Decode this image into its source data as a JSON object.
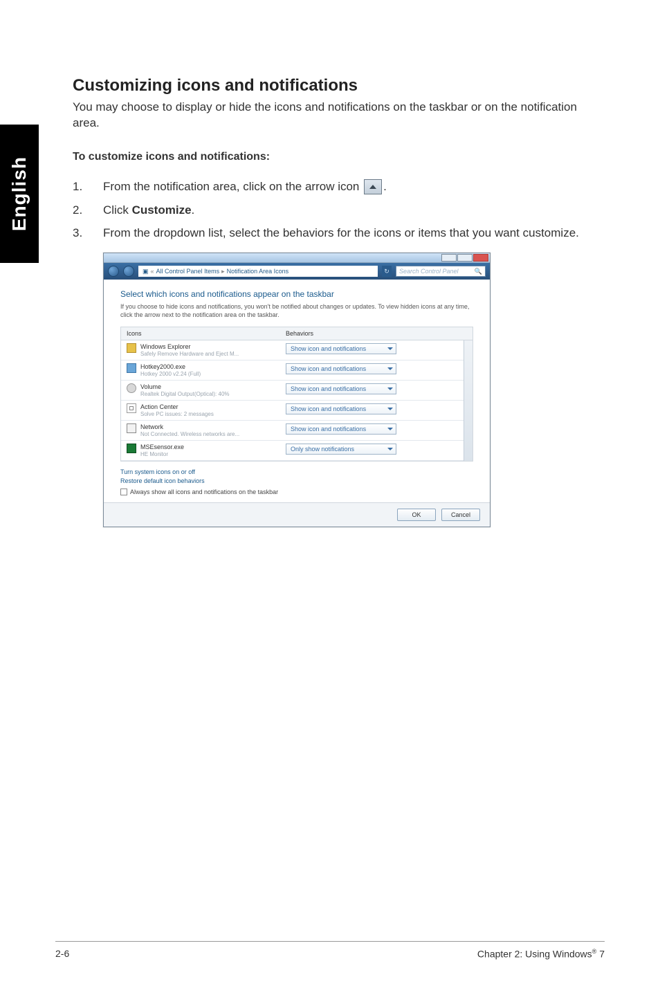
{
  "sidebar": {
    "label": "English"
  },
  "heading": "Customizing icons and notifications",
  "intro": "You may choose to display or hide the icons and notifications on the taskbar or on the notification area.",
  "subhead": "To customize icons and notifications:",
  "steps": {
    "s1_pre": "From the notification area, click on the arrow icon ",
    "s1_post": ".",
    "s2_pre": "Click ",
    "s2_bold": "Customize",
    "s2_post": ".",
    "s3": "From the dropdown list, select the behaviors for the icons or items that you want customize."
  },
  "win": {
    "addr_parts": [
      "All Control Panel Items",
      "Notification Area Icons"
    ],
    "search_placeholder": "Search Control Panel",
    "title": "Select which icons and notifications appear on the taskbar",
    "desc": "If you choose to hide icons and notifications, you won't be notified about changes or updates. To view hidden icons at any time, click the arrow next to the notification area on the taskbar.",
    "col_icons": "Icons",
    "col_behaviors": "Behaviors",
    "rows": [
      {
        "name": "Windows Explorer",
        "sub": "Safely Remove Hardware and Eject M...",
        "behavior": "Show icon and notifications"
      },
      {
        "name": "Hotkey2000.exe",
        "sub": "Hotkey 2000 v2.24 (Full)",
        "behavior": "Show icon and notifications"
      },
      {
        "name": "Volume",
        "sub": "Realtek Digital Output(Optical): 40%",
        "behavior": "Show icon and notifications"
      },
      {
        "name": "Action Center",
        "sub": "Solve PC issues: 2 messages",
        "behavior": "Show icon and notifications"
      },
      {
        "name": "Network",
        "sub": "Not Connected. Wireless networks are...",
        "behavior": "Show icon and notifications"
      },
      {
        "name": "MSEsensor.exe",
        "sub": "HE Monitor",
        "behavior": "Only show notifications"
      }
    ],
    "link1": "Turn system icons on or off",
    "link2": "Restore default icon behaviors",
    "checkbox": "Always show all icons and notifications on the taskbar",
    "ok": "OK",
    "cancel": "Cancel"
  },
  "footer": {
    "left": "2-6",
    "right_pre": "Chapter 2: Using Windows",
    "right_reg": "®",
    "right_post": " 7"
  }
}
